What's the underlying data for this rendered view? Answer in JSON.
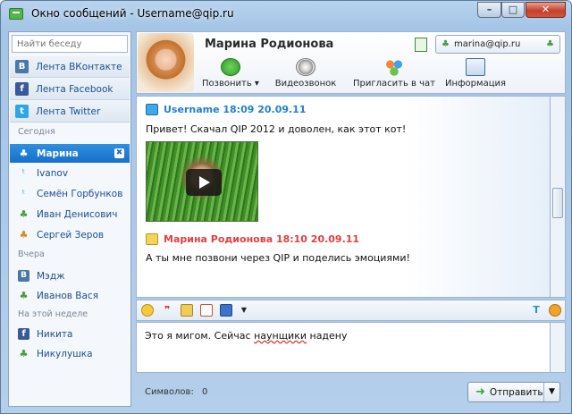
{
  "window": {
    "title": "Окно сообщений - Username@qip.ru",
    "min": "–",
    "max": "□",
    "close": "✕"
  },
  "sidebar": {
    "search_placeholder": "Найти беседу",
    "feeds": [
      {
        "label": "Лента ВКонтакте",
        "icon": "vk-icon",
        "glyph": "B",
        "color": "#4a76a8"
      },
      {
        "label": "Лента Facebook",
        "icon": "facebook-icon",
        "glyph": "f",
        "color": "#3b5998"
      },
      {
        "label": "Лента Twitter",
        "icon": "twitter-icon",
        "glyph": "t",
        "color": "#2fa6e6"
      }
    ],
    "sections": [
      "Сегодня",
      "Вчера",
      "На этой неделе"
    ],
    "today": [
      "Марина",
      "Ivanov",
      "Семён Горбунков",
      "Иван Денисович",
      "Сергей Зеров"
    ],
    "yesterday": [
      "Мэдж",
      "Иванов Вася"
    ],
    "week": [
      "Никита",
      "Никулушка"
    ],
    "close_glyph": "✖"
  },
  "header": {
    "name": "Марина Родионова",
    "account": "marina@qip.ru",
    "actions": [
      "Позвонить ▾",
      "Видеозвонок",
      "Пригласить в чат",
      "Информация"
    ]
  },
  "messages": [
    {
      "header": "Username 18:09 20.09.11",
      "text": "Привет! Скачал QIP 2012 и доволен, как этот кот!"
    },
    {
      "header": "Марина Родионова 18:10 20.09.11",
      "text": "А ты мне позвони через QIP и поделись эмоциями!"
    }
  ],
  "input": {
    "before": "Это я мигом. Сейчас ",
    "misspelled": "наунщики",
    "after": " надену"
  },
  "footer": {
    "chars_label": "Символов:",
    "chars_value": "0",
    "send_label": "Отправить",
    "send_dropdown": "▼"
  }
}
